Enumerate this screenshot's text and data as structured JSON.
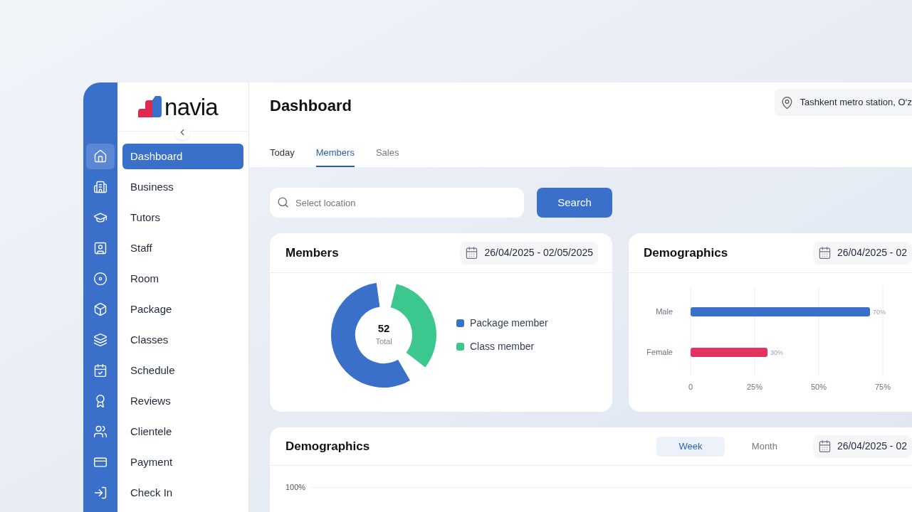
{
  "logo": {
    "text": "navia"
  },
  "sidebar": {
    "items": [
      {
        "label": "Dashboard",
        "selected": true
      },
      {
        "label": "Business",
        "selected": false
      },
      {
        "label": "Tutors",
        "selected": false
      },
      {
        "label": "Staff",
        "selected": false
      },
      {
        "label": "Room",
        "selected": false
      },
      {
        "label": "Package",
        "selected": false
      },
      {
        "label": "Classes",
        "selected": false
      },
      {
        "label": "Schedule",
        "selected": false
      },
      {
        "label": "Reviews",
        "selected": false
      },
      {
        "label": "Clientele",
        "selected": false
      },
      {
        "label": "Payment",
        "selected": false
      },
      {
        "label": "Check In",
        "selected": false
      }
    ]
  },
  "header": {
    "title": "Dashboard",
    "location": "Tashkent metro station, O‘z"
  },
  "tabs": [
    {
      "label": "Today",
      "selected": false
    },
    {
      "label": "Members",
      "selected": true
    },
    {
      "label": "Sales",
      "selected": false
    }
  ],
  "search": {
    "placeholder": "Select location",
    "button": "Search"
  },
  "members_card": {
    "title": "Members",
    "date_range": "26/04/2025 - 02/05/2025",
    "total": "52",
    "total_label": "Total",
    "legend": [
      {
        "label": "Package member",
        "color": "#3a6fca"
      },
      {
        "label": "Class member",
        "color": "#3cc78f"
      }
    ]
  },
  "demographics_card": {
    "title": "Demographics",
    "date_range": "26/04/2025 - 02",
    "chart_data": {
      "type": "bar",
      "orientation": "horizontal",
      "categories": [
        "Male",
        "Female"
      ],
      "values": [
        70,
        30
      ],
      "colors": [
        "#3a6fca",
        "#e5335f"
      ],
      "xlim": [
        0,
        75
      ],
      "xticks": [
        {
          "value": 0,
          "label": "0"
        },
        {
          "value": 25,
          "label": "25%"
        },
        {
          "value": 50,
          "label": "50%"
        },
        {
          "value": 75,
          "label": "75%"
        }
      ],
      "value_labels": [
        "70%",
        "30%"
      ]
    }
  },
  "demographics_trend": {
    "title": "Demographics",
    "periods": [
      {
        "label": "Week",
        "selected": true
      },
      {
        "label": "Month",
        "selected": false
      }
    ],
    "date_range": "26/04/2025 - 02",
    "axis_label": "100%"
  }
}
